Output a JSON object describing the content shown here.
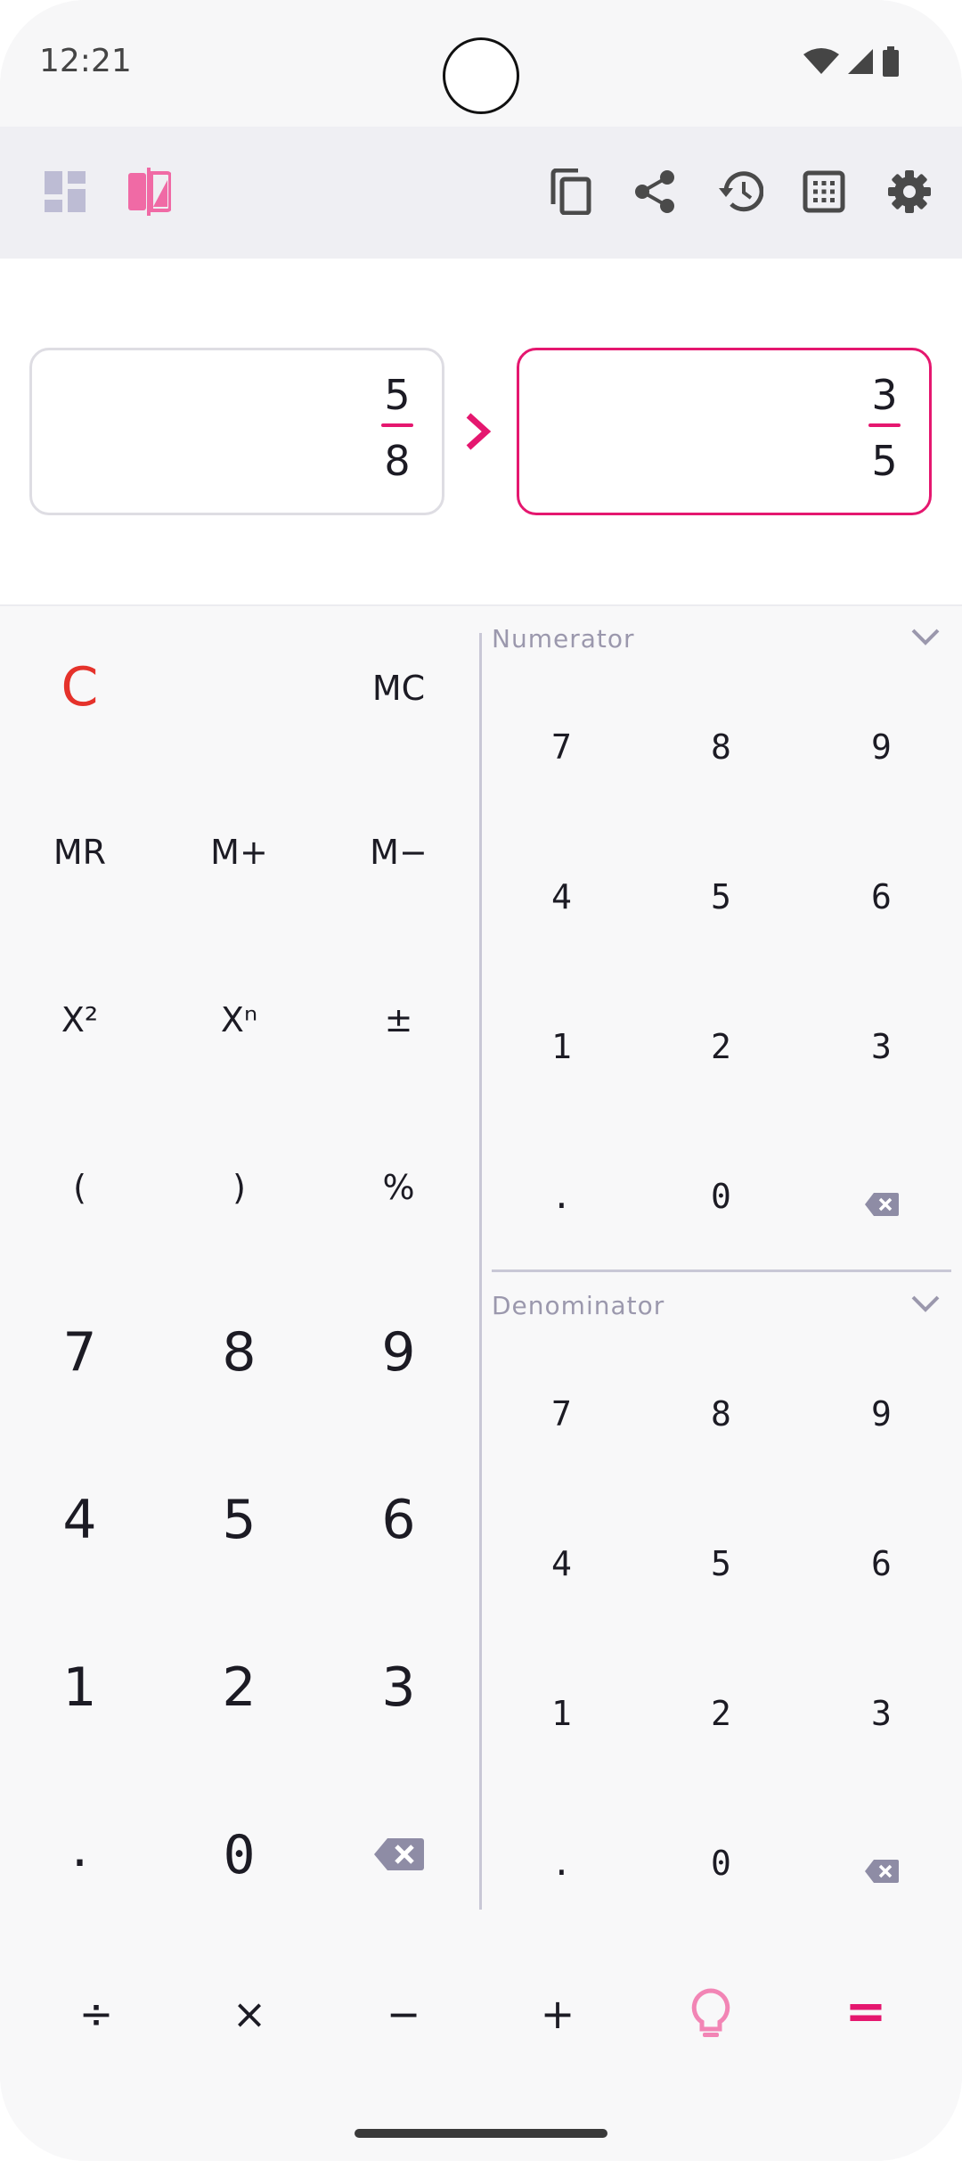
{
  "status_bar": {
    "time": "12:21"
  },
  "toolbar": {
    "left_icons": [
      "dashboard-icon",
      "compare-icon"
    ],
    "right_icons": [
      "copy-icon",
      "share-icon",
      "history-icon",
      "keypad-grid-icon",
      "settings-icon"
    ]
  },
  "display": {
    "left_fraction": {
      "numerator": "5",
      "denominator": "8"
    },
    "right_fraction": {
      "numerator": "3",
      "denominator": "5"
    }
  },
  "left_pad": {
    "clear": "C",
    "memory": {
      "mc": "MC",
      "mr": "MR",
      "mplus": "M+",
      "mminus": "M−"
    },
    "functions": {
      "square": "X²",
      "power": "Xⁿ",
      "plusminus": "±",
      "lparen": "(",
      "rparen": ")",
      "percent": "%"
    },
    "digits": {
      "d7": "7",
      "d8": "8",
      "d9": "9",
      "d4": "4",
      "d5": "5",
      "d6": "6",
      "d1": "1",
      "d2": "2",
      "d3": "3",
      "dot": ".",
      "d0": "0"
    }
  },
  "numerator_pad": {
    "label": "Numerator",
    "digits": {
      "d7": "7",
      "d8": "8",
      "d9": "9",
      "d4": "4",
      "d5": "5",
      "d6": "6",
      "d1": "1",
      "d2": "2",
      "d3": "3",
      "dot": ".",
      "d0": "0"
    }
  },
  "denominator_pad": {
    "label": "Denominator",
    "digits": {
      "d7": "7",
      "d8": "8",
      "d9": "9",
      "d4": "4",
      "d5": "5",
      "d6": "6",
      "d1": "1",
      "d2": "2",
      "d3": "3",
      "dot": ".",
      "d0": "0"
    }
  },
  "operators": {
    "divide": "÷",
    "multiply": "×",
    "minus": "−",
    "plus": "+",
    "equals": "="
  },
  "colors": {
    "accent": "#e5176f",
    "clear_red": "#e5322b",
    "muted": "#9b98ad",
    "icon_gray": "#4a4a4a"
  }
}
